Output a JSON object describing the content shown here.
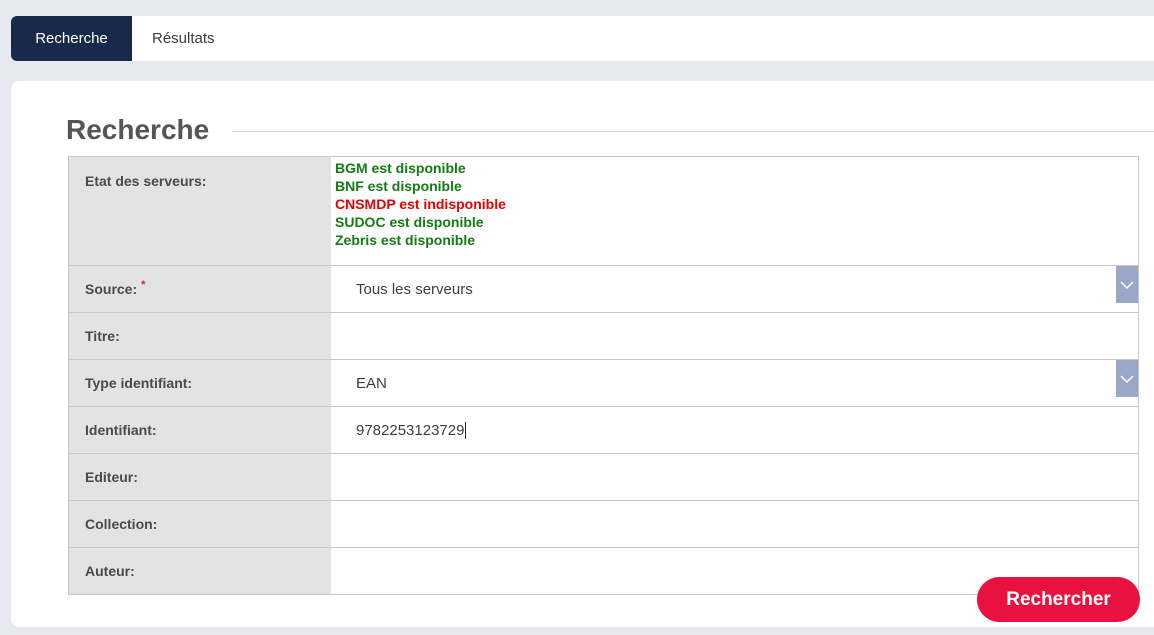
{
  "tabs": [
    {
      "label": "Recherche",
      "active": true
    },
    {
      "label": "Résultats",
      "active": false
    }
  ],
  "section_title": "Recherche",
  "colors": {
    "tab_active_bg": "#172a4a",
    "available": "#147a14",
    "unavailable": "#e60000",
    "button": "#e8113f",
    "select_arrow_bg": "#9aa7c7"
  },
  "server_status": {
    "label": "Etat des serveurs:",
    "items": [
      {
        "text": "BGM est disponible",
        "status": "available"
      },
      {
        "text": "BNF est disponible",
        "status": "available"
      },
      {
        "text": "CNSMDP est indisponible",
        "status": "unavailable"
      },
      {
        "text": "SUDOC est disponible",
        "status": "available"
      },
      {
        "text": "Zebris est disponible",
        "status": "available"
      }
    ]
  },
  "fields": {
    "source": {
      "label": "Source:",
      "required_mark": "*",
      "value": "Tous les serveurs"
    },
    "titre": {
      "label": "Titre:",
      "value": ""
    },
    "type_identifiant": {
      "label": "Type identifiant:",
      "value": "EAN"
    },
    "identifiant": {
      "label": "Identifiant:",
      "value": "9782253123729"
    },
    "editeur": {
      "label": "Editeur:",
      "value": ""
    },
    "collection": {
      "label": "Collection:",
      "value": ""
    },
    "auteur": {
      "label": "Auteur:",
      "value": ""
    }
  },
  "icons": {
    "select_arrow": "chevron-down-icon"
  },
  "search_button_label": "Rechercher"
}
